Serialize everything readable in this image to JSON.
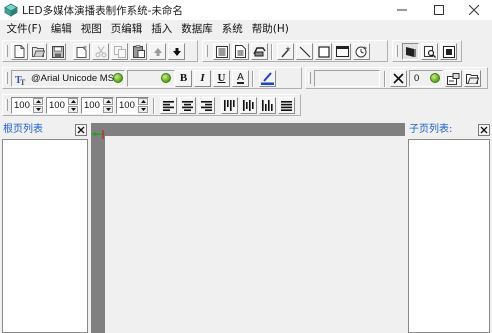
{
  "window": {
    "title": "LED多媒体演播表制作系统-未命名",
    "controls": [
      "minimize",
      "maximize",
      "close"
    ]
  },
  "menu": {
    "items": [
      {
        "label": "文件(F)"
      },
      {
        "label": "编辑"
      },
      {
        "label": "视图"
      },
      {
        "label": "页编辑"
      },
      {
        "label": "插入"
      },
      {
        "label": "数据库"
      },
      {
        "label": "系统"
      },
      {
        "label": "帮助(H)"
      }
    ]
  },
  "toolbar_main": {
    "icons": [
      "new-file-icon",
      "open-folder-icon",
      "save-icon",
      "new-page-icon",
      "cut-icon",
      "copy-icon",
      "paste-icon",
      "move-up-icon",
      "move-down-icon",
      "text-page-icon",
      "document-icon",
      "print-preview-icon",
      "magic-wand-icon",
      "line-icon",
      "rectangle-icon",
      "window-icon",
      "clock-icon",
      "picture-tool-icon",
      "zoom-page-icon",
      "fullscreen-icon"
    ]
  },
  "toolbar_font": {
    "font_name": "@Arial Unicode MS",
    "font_size": "",
    "bold_label": "B",
    "italic_label": "I",
    "underline_label": "U",
    "color_label": "A",
    "effect_value": "",
    "count_value": "0"
  },
  "toolbar_spacing": {
    "values": [
      "100",
      "100",
      "100",
      "100"
    ]
  },
  "panes": {
    "left_title": "根页列表",
    "right_title": "子页列表:"
  },
  "colors": {
    "canvas_background": "#808080",
    "canvas_inner": "#f0f0f0",
    "pane_title": "#1b5fd0",
    "accent_green": "#5ea418"
  }
}
